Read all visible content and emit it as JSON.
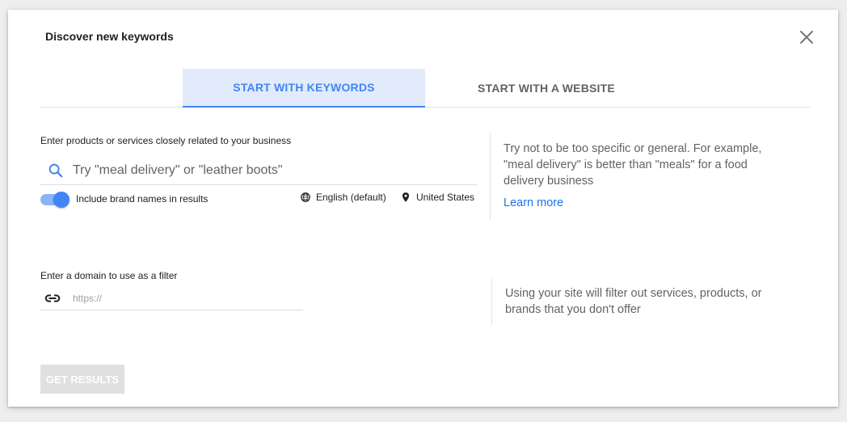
{
  "dialog": {
    "title": "Discover new keywords",
    "close_icon": "close-icon"
  },
  "tabs": [
    {
      "label": "START WITH KEYWORDS",
      "active": true
    },
    {
      "label": "START WITH A WEBSITE",
      "active": false
    }
  ],
  "keywords": {
    "label": "Enter products or services closely related to your business",
    "placeholder": "Try \"meal delivery\" or \"leather boots\"",
    "value": "",
    "icon": "search-icon",
    "brand_toggle": {
      "label": "Include brand names in results",
      "on": true
    },
    "language": {
      "icon": "globe-icon",
      "label": "English (default)"
    },
    "location": {
      "icon": "location-pin-icon",
      "label": "United States"
    },
    "hint_lines": [
      "Try not to be too specific or general. For example,",
      "\"meal delivery\" is better than \"meals\" for a food",
      "delivery business"
    ],
    "learn_more": "Learn more"
  },
  "domain": {
    "label": "Enter a domain to use as a filter",
    "placeholder": "https://",
    "value": "",
    "icon": "link-icon",
    "hint_lines": [
      "Using your site will filter out services, products, or",
      "brands that you don't offer"
    ]
  },
  "actions": {
    "get_results": "GET RESULTS",
    "enabled": false
  },
  "colors": {
    "accent": "#4285f4",
    "accent_light": "#e1ebfb",
    "link": "#1a73e8",
    "muted_text": "#5f6368",
    "disabled_button": "#e0e0e0"
  }
}
